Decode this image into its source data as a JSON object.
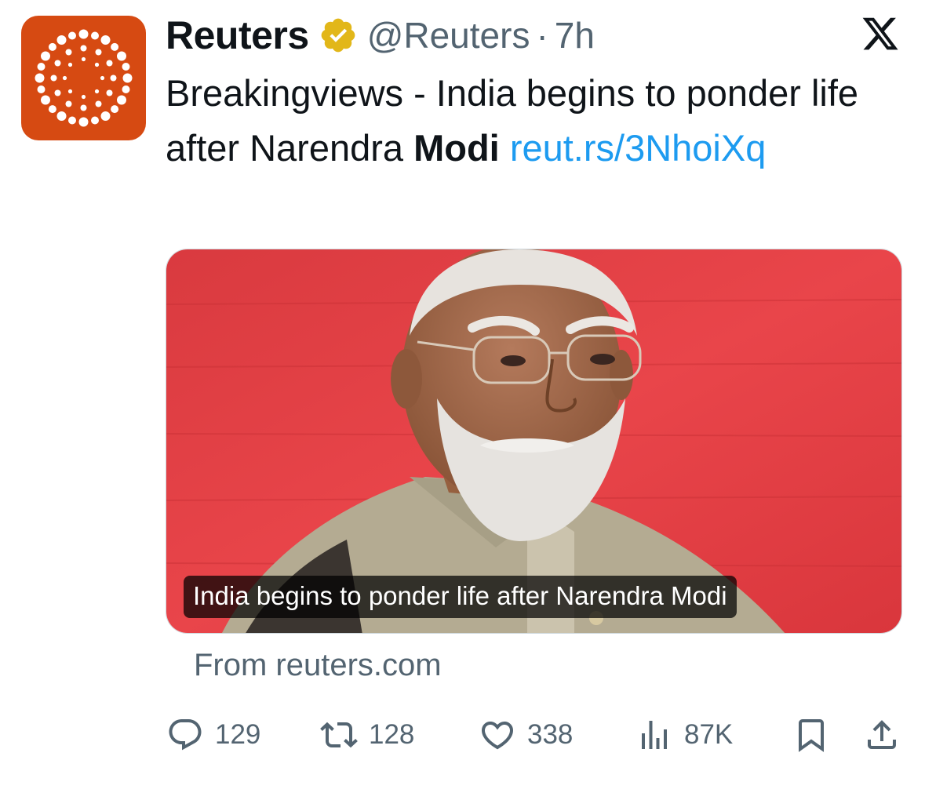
{
  "account": {
    "display_name": "Reuters",
    "handle": "@Reuters",
    "separator": "·",
    "time_ago": "7h",
    "verified_icon": "gold-verified-badge-icon",
    "avatar_color": "#d64a12"
  },
  "platform_icon": "x-logo-icon",
  "tweet": {
    "text_part1": "Breakingviews - India begins to ponder life after Narendra ",
    "text_bold": "Modi",
    "text_space": " ",
    "link": "reut.rs/3NhoiXq",
    "link_color": "#1d9bf0"
  },
  "card": {
    "image_caption": "India begins to ponder life after Narendra Modi",
    "source": "From reuters.com"
  },
  "actions": {
    "replies": "129",
    "reposts": "128",
    "likes": "338",
    "views": "87K",
    "reply_icon": "reply-icon",
    "repost_icon": "repost-icon",
    "like_icon": "heart-icon",
    "views_icon": "views-chart-icon",
    "bookmark_icon": "bookmark-icon",
    "share_icon": "share-icon"
  }
}
